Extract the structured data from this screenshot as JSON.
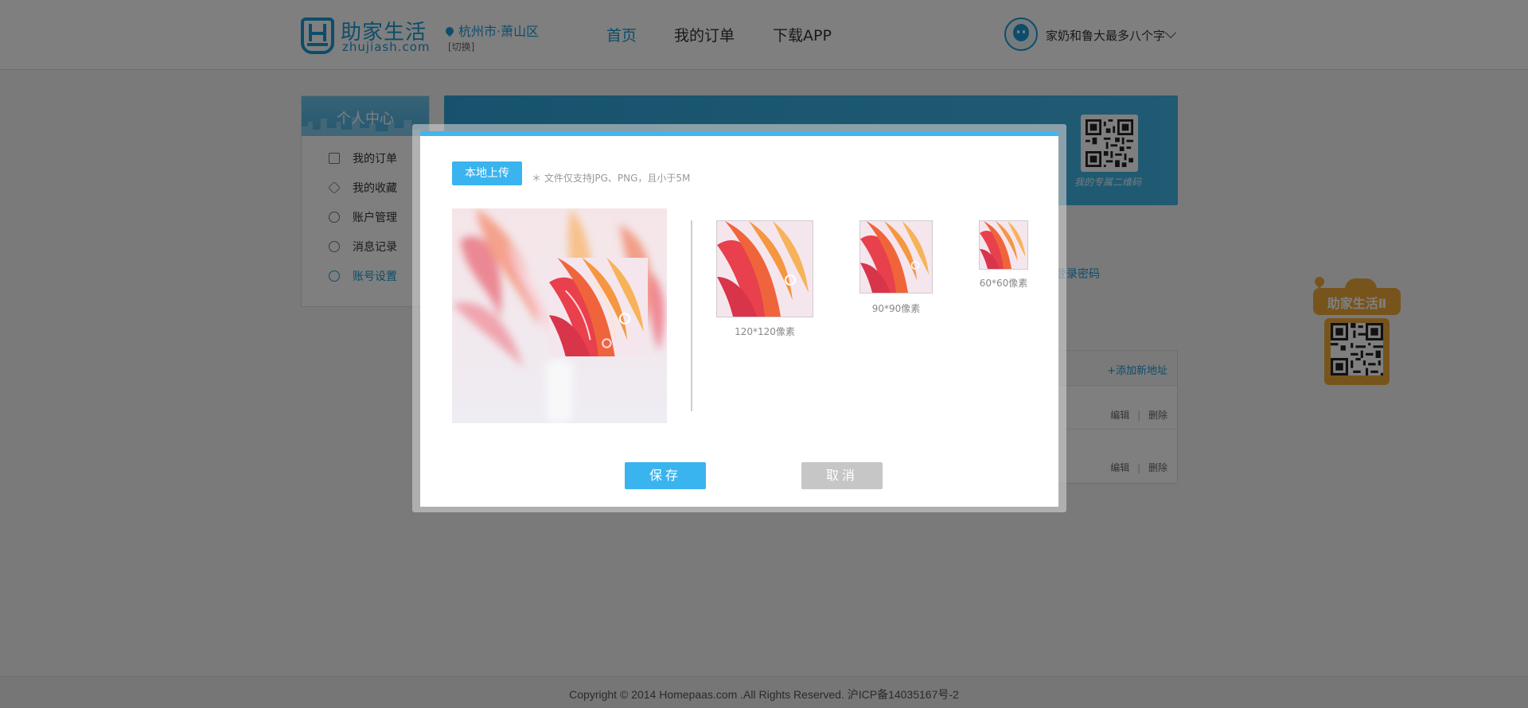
{
  "header": {
    "logo_cn": "助家生活",
    "logo_en": "zhujiash.com",
    "city": "杭州市·萧山区",
    "city_switch": "[切换]",
    "nav": [
      {
        "label": "首页",
        "active": true
      },
      {
        "label": "我的订单",
        "active": false
      },
      {
        "label": "下载APP",
        "active": false
      }
    ],
    "user_name": "家奶和鲁大最多八个字",
    "accent": "#1b9ad6"
  },
  "sidebar": {
    "title": "个人中心",
    "items": [
      {
        "label": "我的订单",
        "icon": "list-icon"
      },
      {
        "label": "我的收藏",
        "icon": "star-icon"
      },
      {
        "label": "账户管理",
        "icon": "account-icon"
      },
      {
        "label": "消息记录",
        "icon": "message-icon"
      },
      {
        "label": "账号设置",
        "icon": "gear-icon",
        "active": true
      }
    ]
  },
  "banner": {
    "qr_caption": "我的专属二维码"
  },
  "background": {
    "password_link": "登录密码",
    "add_address": "+添加新地址",
    "rows": [
      {
        "edit": "编辑",
        "sep": "|",
        "delete": "删除"
      },
      {
        "edit": "编辑",
        "sep": "|",
        "delete": "删除"
      }
    ]
  },
  "promo": {
    "title": "助家生活Ⅱ"
  },
  "footer": {
    "text": "Copyright © 2014 Homepaas.com .All Rights Reserved. 沪ICP备14035167号-2"
  },
  "modal": {
    "upload_label": "本地上传",
    "upload_hint": "＊ 文件仅支持JPG、PNG，且小于5M",
    "previews": [
      {
        "label": "120*120像素"
      },
      {
        "label": "90*90像素"
      },
      {
        "label": "60*60像素"
      }
    ],
    "save_label": "保存",
    "cancel_label": "取消",
    "accent": "#3ab4ee"
  }
}
